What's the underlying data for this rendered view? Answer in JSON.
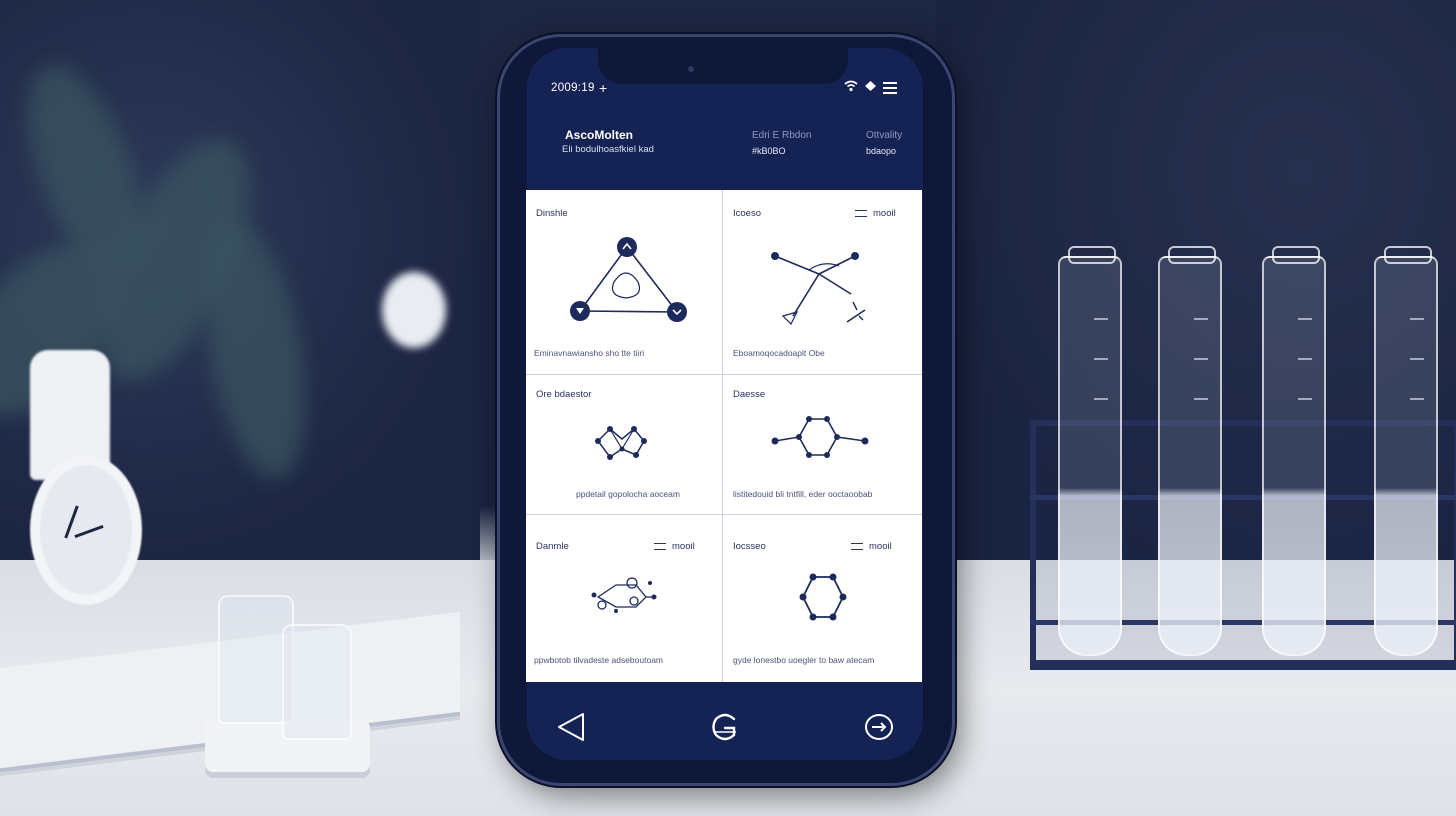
{
  "status_bar": {
    "time": "2009:19",
    "plus": "+"
  },
  "header": {
    "title": "AscoMolten",
    "subtitle": "Eli bodulhoasfkiel kad",
    "col1_label": "Edri E Rbdon",
    "col1_value": "#kB0BO",
    "col2_label": "Ottvality",
    "col2_value": "bdaopo"
  },
  "cards": [
    {
      "label": "Dinshle",
      "meta": "",
      "caption": "Eminavnawiansho sho tte tiiri"
    },
    {
      "label": "Icoeso",
      "meta": "mooil",
      "caption": "Eboamoqocadoaplt Obe"
    },
    {
      "label": "Ore bdaestor",
      "meta": "",
      "caption": "ppdetail gopolocha aoceam"
    },
    {
      "label": "Daesse",
      "meta": "",
      "caption": "listitedouid bli tntfill, eder ooctaoobab"
    },
    {
      "label": "Danmle",
      "meta": "mooil",
      "caption": "ppwbotob tilvadeste adseboutoam"
    },
    {
      "label": "Iocsseo",
      "meta": "mooil",
      "caption": "gyde lonestbo uoegler to baw atecam"
    }
  ],
  "colors": {
    "navy": "#152254",
    "ink": "#1d2a5c",
    "card_bg": "#ffffff"
  },
  "icons": {
    "back": "back-triangle-icon",
    "home": "home-g-icon",
    "forward": "forward-circle-icon"
  }
}
